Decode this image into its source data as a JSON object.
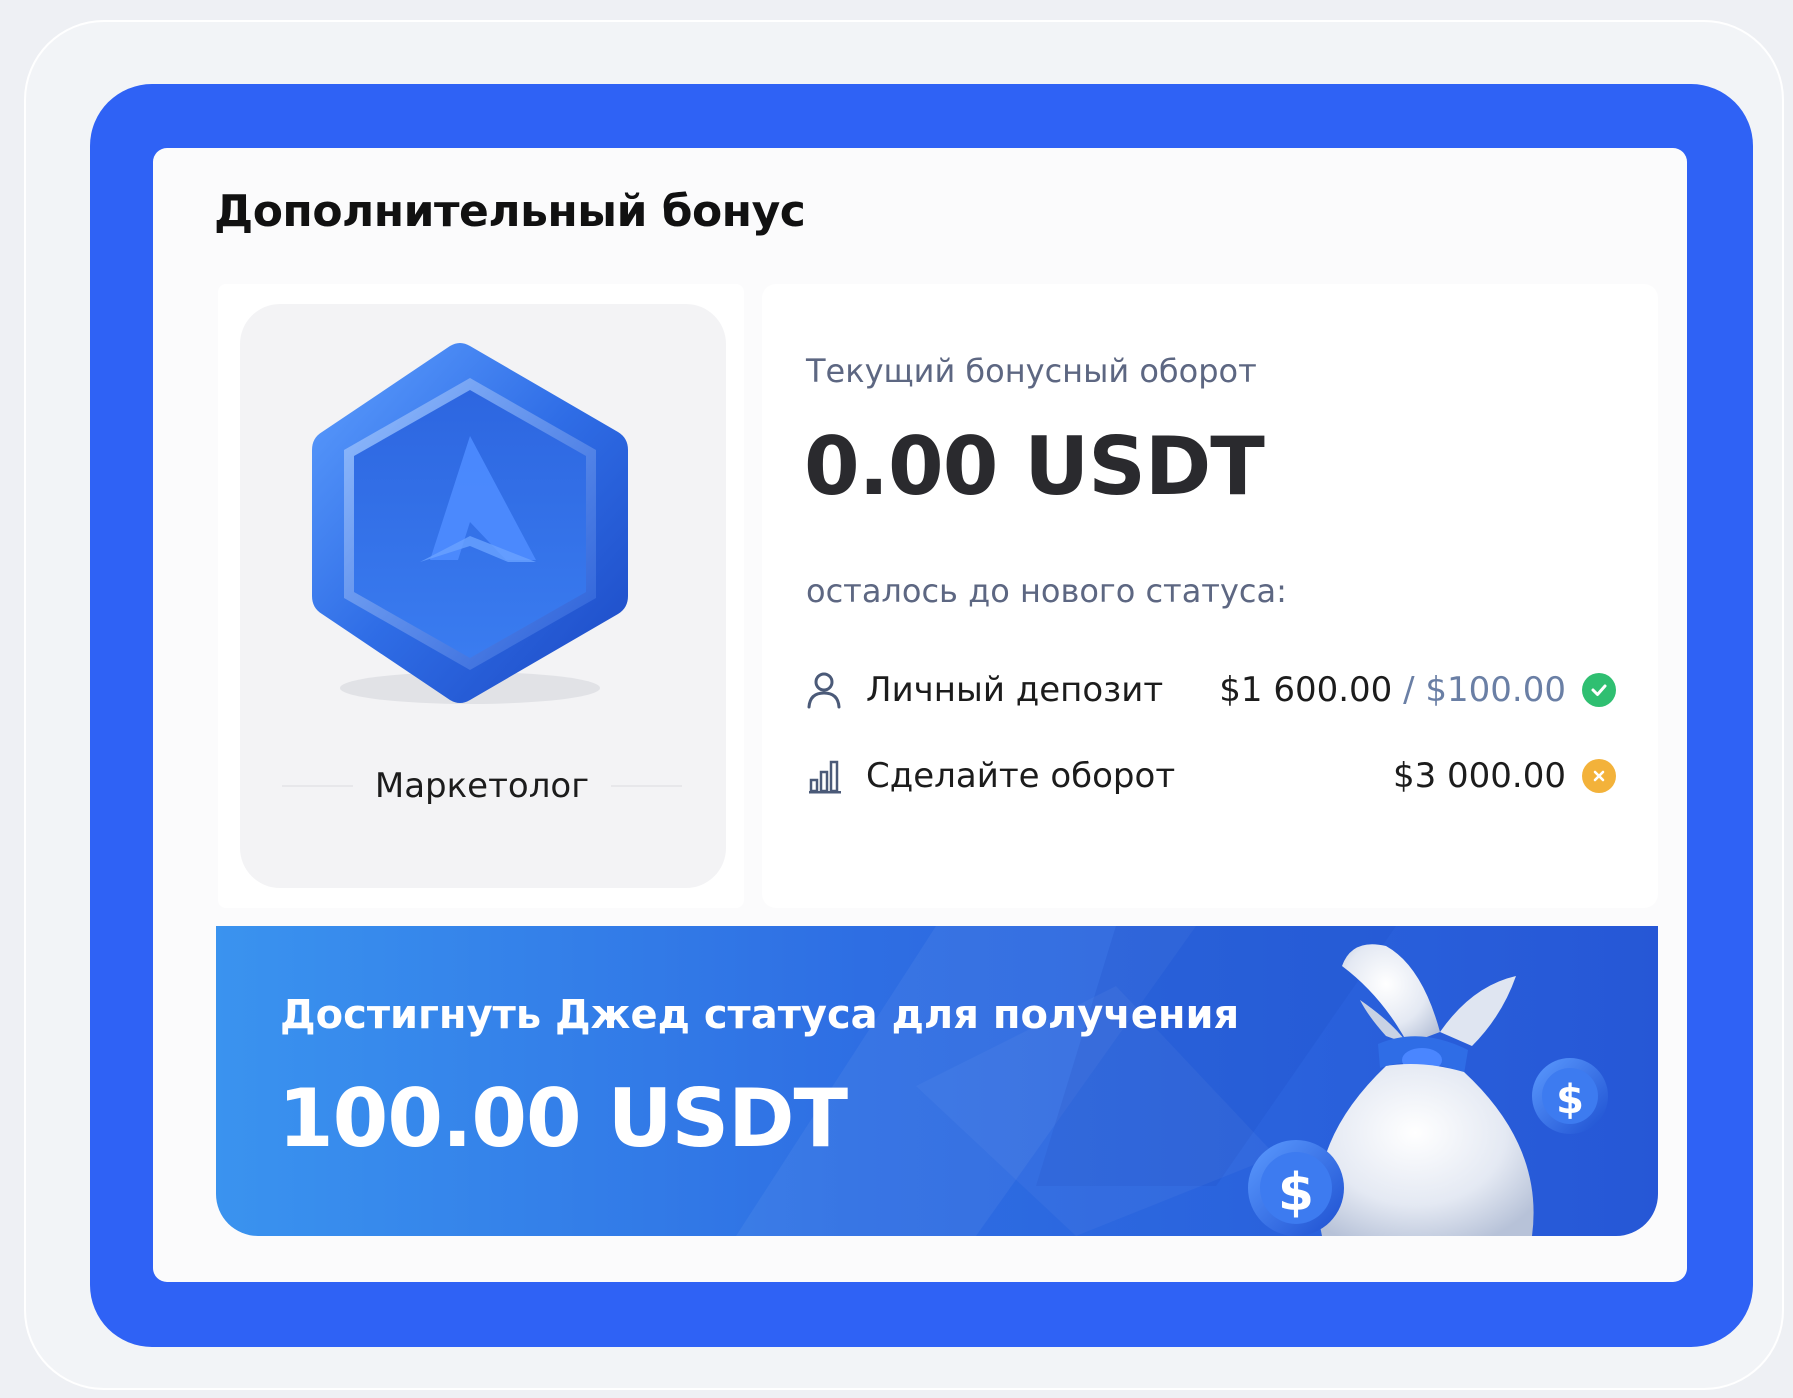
{
  "panel": {
    "title": "Дополнительный бонус"
  },
  "badge": {
    "icon": "hexagon-medal-icon",
    "letter": "A",
    "label": "Маркетолог"
  },
  "turnover": {
    "label": "Текущий бонусный оборот",
    "value": "0.00 USDT"
  },
  "requirements": {
    "heading": "осталось до нового статуса:",
    "items": [
      {
        "icon": "user-icon",
        "label": "Личный депозит",
        "value": "$1 600.00",
        "separator": " / ",
        "target": "$100.00",
        "status": "completed",
        "status_icon": "check-circle-icon",
        "status_color": "#2fbf71"
      },
      {
        "icon": "bar-chart-icon",
        "label": "Сделайте оборот",
        "value": "$3 000.00",
        "status": "incomplete",
        "status_icon": "close-circle-icon",
        "status_color": "#f3b23a"
      }
    ]
  },
  "banner": {
    "title": "Достигнуть Джед статуса для получения",
    "amount": "100.00 USDT",
    "illustration": "money-bag-icon"
  },
  "colors": {
    "frame": "#2f62f5",
    "banner_start": "#3a93ef",
    "banner_end": "#2657d6",
    "success": "#2fbf71",
    "warning": "#f3b23a"
  }
}
